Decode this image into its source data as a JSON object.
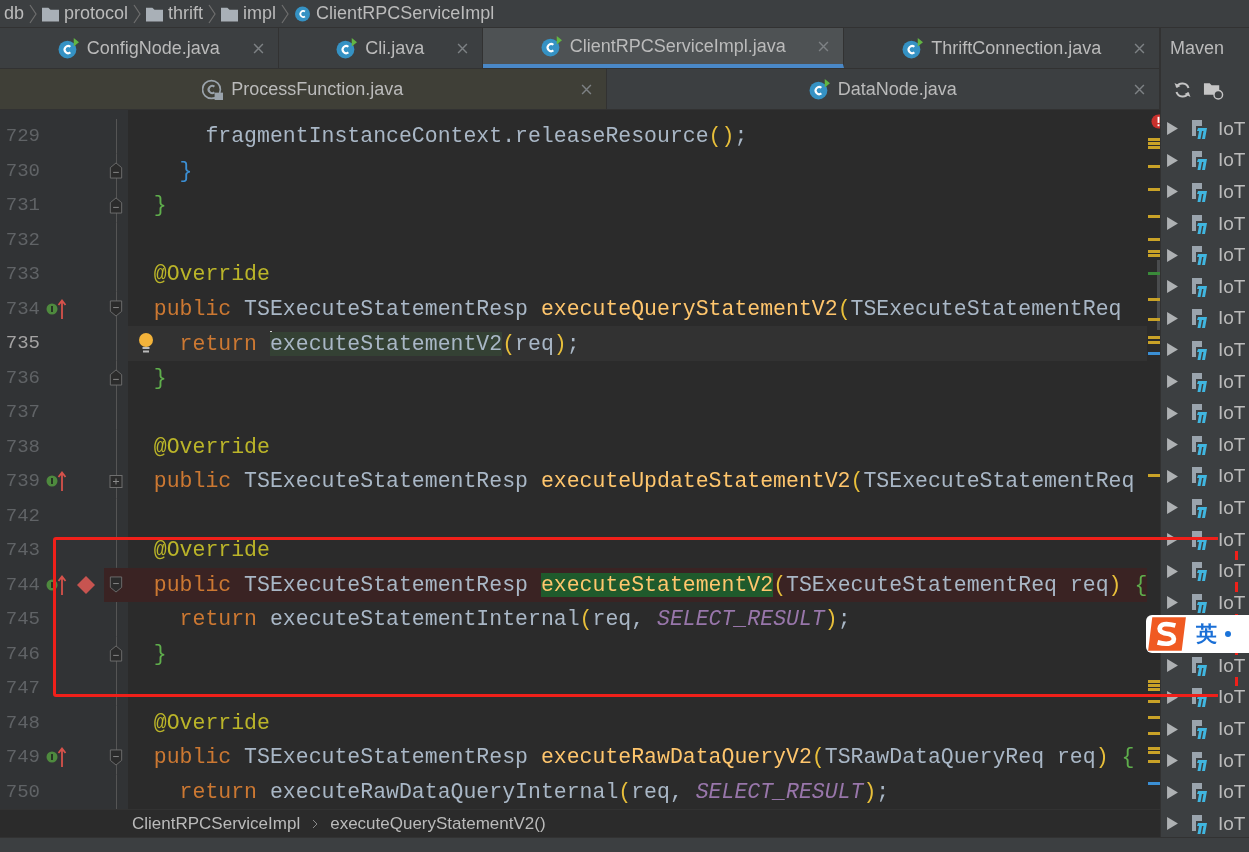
{
  "breadcrumbs": [
    {
      "label": "db",
      "kind": "folder"
    },
    {
      "label": "protocol",
      "kind": "folder"
    },
    {
      "label": "thrift",
      "kind": "folder"
    },
    {
      "label": "impl",
      "kind": "folder"
    },
    {
      "label": "ClientRPCServiceImpl",
      "kind": "class"
    }
  ],
  "tab_rows": [
    {
      "tabs": [
        {
          "label": "ConfigNode.java",
          "kind": "class",
          "selected": false
        },
        {
          "label": "Cli.java",
          "kind": "class",
          "selected": false
        },
        {
          "label": "ClientRPCServiceImpl.java",
          "kind": "class",
          "selected": true
        },
        {
          "label": "ThriftConnection.java",
          "kind": "class",
          "selected": false
        }
      ]
    },
    {
      "tabs": [
        {
          "label": "ProcessFunction.java",
          "kind": "library",
          "selected": false
        },
        {
          "label": "DataNode.java",
          "kind": "class",
          "selected": false
        }
      ]
    }
  ],
  "code_lines": [
    {
      "number": "729",
      "kind": "plain",
      "implemented": false,
      "current": false,
      "breakpoint": false,
      "intention": false,
      "tokens": [
        {
          "text": "      fragmentInstanceContext.releaseResource",
          "kind": "plain"
        },
        {
          "text": "()",
          "kind": "paren"
        },
        {
          "text": ";",
          "kind": "plain"
        }
      ]
    },
    {
      "number": "730",
      "kind": "fold-close",
      "implemented": false,
      "current": false,
      "breakpoint": false,
      "intention": false,
      "tokens": [
        {
          "text": "    }",
          "kind": "brace-blue"
        }
      ]
    },
    {
      "number": "731",
      "kind": "fold-close",
      "implemented": false,
      "current": false,
      "breakpoint": false,
      "intention": false,
      "tokens": [
        {
          "text": "  }",
          "kind": "brace-green"
        }
      ]
    },
    {
      "number": "732",
      "kind": "plain",
      "implemented": false,
      "current": false,
      "breakpoint": false,
      "intention": false
    },
    {
      "number": "733",
      "kind": "plain",
      "implemented": false,
      "current": false,
      "breakpoint": false,
      "intention": false,
      "tokens": [
        {
          "text": "  @Override",
          "kind": "annotation"
        }
      ]
    },
    {
      "number": "734",
      "kind": "fold-open",
      "implemented": true,
      "current": false,
      "breakpoint": false,
      "intention": false,
      "tokens": [
        {
          "text": "  public",
          "kind": "keyword"
        },
        {
          "text": " TSExecuteStatementResp ",
          "kind": "plain"
        },
        {
          "text": "executeQueryStatementV2",
          "kind": "method"
        },
        {
          "text": "(",
          "kind": "paren"
        },
        {
          "text": "TSExecuteStatementReq",
          "kind": "plain"
        }
      ]
    },
    {
      "number": "735",
      "kind": "plain",
      "implemented": false,
      "current": true,
      "breakpoint": false,
      "intention": true,
      "tokens": [
        {
          "text": "    return ",
          "kind": "keyword"
        },
        {
          "text": "executeStatementV2",
          "kind": "usage",
          "caret": true
        },
        {
          "text": "(",
          "kind": "paren"
        },
        {
          "text": "req",
          "kind": "plain"
        },
        {
          "text": ")",
          "kind": "paren"
        },
        {
          "text": ";",
          "kind": "plain"
        }
      ]
    },
    {
      "number": "736",
      "kind": "fold-close",
      "implemented": false,
      "current": false,
      "breakpoint": false,
      "intention": false,
      "tokens": [
        {
          "text": "  }",
          "kind": "brace-green"
        }
      ]
    },
    {
      "number": "737",
      "kind": "plain",
      "implemented": false,
      "current": false,
      "breakpoint": false,
      "intention": false
    },
    {
      "number": "738",
      "kind": "plain",
      "implemented": false,
      "current": false,
      "breakpoint": false,
      "intention": false,
      "tokens": [
        {
          "text": "  @Override",
          "kind": "annotation"
        }
      ]
    },
    {
      "number": "739",
      "kind": "collapsed",
      "implemented": true,
      "current": false,
      "breakpoint": false,
      "intention": false,
      "tokens": [
        {
          "text": "  public",
          "kind": "keyword"
        },
        {
          "text": " TSExecuteStatementResp ",
          "kind": "plain"
        },
        {
          "text": "executeUpdateStatementV2",
          "kind": "method"
        },
        {
          "text": "(",
          "kind": "paren"
        },
        {
          "text": "TSExecuteStatementReq",
          "kind": "plain"
        }
      ]
    },
    {
      "number": "742",
      "kind": "plain",
      "implemented": false,
      "current": false,
      "breakpoint": false,
      "intention": false
    },
    {
      "number": "743",
      "kind": "plain",
      "implemented": false,
      "current": false,
      "breakpoint": false,
      "intention": false,
      "tokens": [
        {
          "text": "  @Override",
          "kind": "annotation"
        }
      ]
    },
    {
      "number": "744",
      "kind": "fold-open",
      "implemented": true,
      "current": false,
      "breakpoint": true,
      "intention": false,
      "tokens": [
        {
          "text": "  public",
          "kind": "keyword"
        },
        {
          "text": " TSExecuteStatementResp ",
          "kind": "plain"
        },
        {
          "text": "executeStatementV2",
          "kind": "method-match"
        },
        {
          "text": "(",
          "kind": "paren"
        },
        {
          "text": "TSExecuteStatementReq req",
          "kind": "plain"
        },
        {
          "text": ")",
          "kind": "paren"
        },
        {
          "text": " {",
          "kind": "brace-green"
        }
      ]
    },
    {
      "number": "745",
      "kind": "plain",
      "implemented": false,
      "current": false,
      "breakpoint": false,
      "intention": false,
      "tokens": [
        {
          "text": "    return",
          "kind": "keyword"
        },
        {
          "text": " executeStatementInternal",
          "kind": "plain"
        },
        {
          "text": "(",
          "kind": "paren"
        },
        {
          "text": "req, ",
          "kind": "plain"
        },
        {
          "text": "SELECT_RESULT",
          "kind": "constant"
        },
        {
          "text": ")",
          "kind": "paren"
        },
        {
          "text": ";",
          "kind": "plain"
        }
      ]
    },
    {
      "number": "746",
      "kind": "fold-close",
      "implemented": false,
      "current": false,
      "breakpoint": false,
      "intention": false,
      "tokens": [
        {
          "text": "  }",
          "kind": "brace-green"
        }
      ]
    },
    {
      "number": "747",
      "kind": "plain",
      "implemented": false,
      "current": false,
      "breakpoint": false,
      "intention": false
    },
    {
      "number": "748",
      "kind": "plain",
      "implemented": false,
      "current": false,
      "breakpoint": false,
      "intention": false,
      "tokens": [
        {
          "text": "  @Override",
          "kind": "annotation"
        }
      ]
    },
    {
      "number": "749",
      "kind": "fold-open",
      "implemented": true,
      "current": false,
      "breakpoint": false,
      "intention": false,
      "tokens": [
        {
          "text": "  public",
          "kind": "keyword"
        },
        {
          "text": " TSExecuteStatementResp ",
          "kind": "plain"
        },
        {
          "text": "executeRawDataQueryV2",
          "kind": "method"
        },
        {
          "text": "(",
          "kind": "paren"
        },
        {
          "text": "TSRawDataQueryReq req",
          "kind": "plain"
        },
        {
          "text": ")",
          "kind": "paren"
        },
        {
          "text": " {",
          "kind": "brace-green"
        }
      ]
    },
    {
      "number": "750",
      "kind": "plain",
      "implemented": false,
      "current": false,
      "breakpoint": false,
      "intention": false,
      "tokens": [
        {
          "text": "    return",
          "kind": "keyword"
        },
        {
          "text": " executeRawDataQueryInternal",
          "kind": "plain"
        },
        {
          "text": "(",
          "kind": "paren"
        },
        {
          "text": "req, ",
          "kind": "plain"
        },
        {
          "text": "SELECT_RESULT",
          "kind": "constant"
        },
        {
          "text": ")",
          "kind": "paren"
        },
        {
          "text": ";",
          "kind": "plain"
        }
      ]
    }
  ],
  "code_breadcrumbs": [
    "ClientRPCServiceImpl",
    "executeQueryStatementV2()"
  ],
  "maven": {
    "title": "Maven",
    "items": [
      {
        "kind": "module",
        "label": "IoT"
      },
      {
        "kind": "module",
        "label": "IoT"
      },
      {
        "kind": "module",
        "label": "IoT"
      },
      {
        "kind": "module",
        "label": "IoT"
      },
      {
        "kind": "module",
        "label": "IoT"
      },
      {
        "kind": "module",
        "label": "IoT"
      },
      {
        "kind": "module",
        "label": "IoT"
      },
      {
        "kind": "module",
        "label": "IoT"
      },
      {
        "kind": "module",
        "label": "IoT"
      },
      {
        "kind": "module",
        "label": "IoT"
      },
      {
        "kind": "module",
        "label": "IoT"
      },
      {
        "kind": "module",
        "label": "IoT"
      },
      {
        "kind": "module",
        "label": "IoT"
      },
      {
        "kind": "module",
        "label": "IoT"
      },
      {
        "kind": "module",
        "label": "IoT"
      },
      {
        "kind": "module",
        "label": "IoT"
      },
      {
        "kind": "ime-badge",
        "label": "英"
      },
      {
        "kind": "module",
        "label": "IoT"
      },
      {
        "kind": "module",
        "label": "IoT"
      },
      {
        "kind": "module",
        "label": "IoT"
      },
      {
        "kind": "module",
        "label": "IoT"
      },
      {
        "kind": "module",
        "label": "IoT"
      },
      {
        "kind": "module",
        "label": "IoT"
      }
    ]
  }
}
